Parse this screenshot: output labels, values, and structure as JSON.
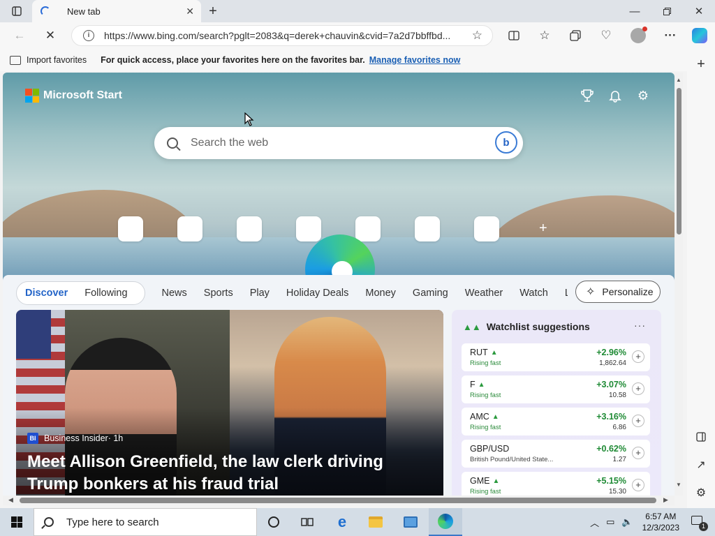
{
  "browser": {
    "tab_title": "New tab",
    "url": "https://www.bing.com/search?pglt=2083&q=derek+chauvin&cvid=7a2d7bbffbd...",
    "favorites_bar": {
      "import_label": "Import favorites",
      "hint": "For quick access, place your favorites here on the favorites bar.",
      "manage_link": "Manage favorites now"
    }
  },
  "page": {
    "brand": "Microsoft Start",
    "search_placeholder": "Search the web",
    "feed_nav": {
      "pill": [
        "Discover",
        "Following"
      ],
      "links": [
        "News",
        "Sports",
        "Play",
        "Holiday Deals",
        "Money",
        "Gaming",
        "Weather",
        "Watch"
      ],
      "cut_label": "Le"
    },
    "personalize_label": "Personalize",
    "news": {
      "source": "Business Insider",
      "source_badge": "BI",
      "age": " · 1h",
      "headline": "Meet Allison Greenfield, the law clerk driving Trump bonkers at his fraud trial"
    },
    "watchlist": {
      "title": "Watchlist suggestions",
      "items": [
        {
          "symbol": "RUT",
          "sub": "Rising fast",
          "change": "+2.96%",
          "price": "1,862.64"
        },
        {
          "symbol": "F",
          "sub": "Rising fast",
          "change": "+3.07%",
          "price": "10.58"
        },
        {
          "symbol": "AMC",
          "sub": "Rising fast",
          "change": "+3.16%",
          "price": "6.86"
        },
        {
          "symbol": "GBP/USD",
          "sub": "British Pound/United State...",
          "change": "+0.62%",
          "price": "1.27"
        },
        {
          "symbol": "GME",
          "sub": "Rising fast",
          "change": "+5.15%",
          "price": "15.30"
        }
      ]
    }
  },
  "taskbar": {
    "search_placeholder": "Type here to search",
    "time": "6:57 AM",
    "date": "12/3/2023",
    "notification_count": "1"
  },
  "colors": {
    "accent": "#2465c8",
    "positive": "#1e8a34",
    "link": "#1a5fb4"
  }
}
